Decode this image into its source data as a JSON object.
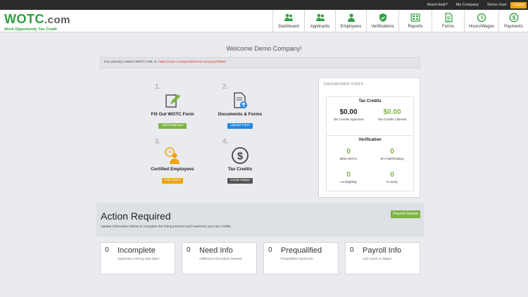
{
  "topbar": {
    "need_help": "Need Help?",
    "my_company": "My Company",
    "user": "Demo User",
    "logout": "Logout"
  },
  "logo": {
    "name": "WOTC",
    "suffix": ".com",
    "tagline": "Work Opportunity Tax Credit"
  },
  "nav": [
    {
      "label": "Dashboard",
      "icon": "people-icon"
    },
    {
      "label": "Applicants",
      "icon": "people-icon"
    },
    {
      "label": "Employees",
      "icon": "person-icon"
    },
    {
      "label": "Verifications",
      "icon": "shield-icon"
    },
    {
      "label": "Reports",
      "icon": "reports-icon"
    },
    {
      "label": "Forms",
      "icon": "document-icon"
    },
    {
      "label": "Hours/Wages",
      "icon": "clock-icon"
    },
    {
      "label": "Payments",
      "icon": "dollar-icon"
    }
  ],
  "welcome": "Welcome Demo Company!",
  "custom_url": {
    "prefix": "Your primary custom WOTC URL is:",
    "url": "https://wotc.com/portal/demo-company/f8850"
  },
  "steps": [
    {
      "num": "1.",
      "title": "Fill Out WOTC Form",
      "button": "Add Employee",
      "color": "#7cb342"
    },
    {
      "num": "2.",
      "title": "Documents & Forms",
      "button": "Upload Form",
      "color": "#1e88e5"
    },
    {
      "num": "3.",
      "title": "Certified Employees",
      "button": "Add Hours",
      "color": "#f0a30a"
    },
    {
      "num": "4.",
      "title": "Tax Credits",
      "button": "Credit Status",
      "color": "#555555"
    }
  ],
  "dashboard_stats": {
    "title": "DASHBOARD STATS",
    "tax_credits": {
      "title": "Tax Credits",
      "approved_value": "$0.00",
      "approved_label": "Tax Credits Approved",
      "claimed_value": "$0.00",
      "claimed_label": "Tax Credits Claimed"
    },
    "verification": {
      "title": "Verification",
      "items": [
        {
          "value": "0",
          "label": "8850 WOTC"
        },
        {
          "value": "0",
          "label": "W-4 Withholding"
        },
        {
          "value": "0",
          "label": "I-9 Eligibility"
        },
        {
          "value": "0",
          "label": "E-Verify"
        }
      ]
    }
  },
  "action": {
    "title": "Action Required",
    "subtitle": "Update information below to complete the hiring process and maximize your tax credits.",
    "payroll_button": "Payroll Upload"
  },
  "cards": [
    {
      "count": "0",
      "title": "Incomplete",
      "sub": "Applicants missing start dates"
    },
    {
      "count": "0",
      "title": "Need Info",
      "sub": "Additional Information Needed"
    },
    {
      "count": "0",
      "title": "Prequalified",
      "sub": "Prequalified Applicants"
    },
    {
      "count": "0",
      "title": "Payroll Info",
      "sub": "Add Hours or Wages"
    }
  ],
  "colors": {
    "brand_green": "#2f9f3f",
    "accent_green": "#7cb342",
    "blue": "#1e88e5",
    "orange": "#f0a30a",
    "red": "#e53935"
  }
}
